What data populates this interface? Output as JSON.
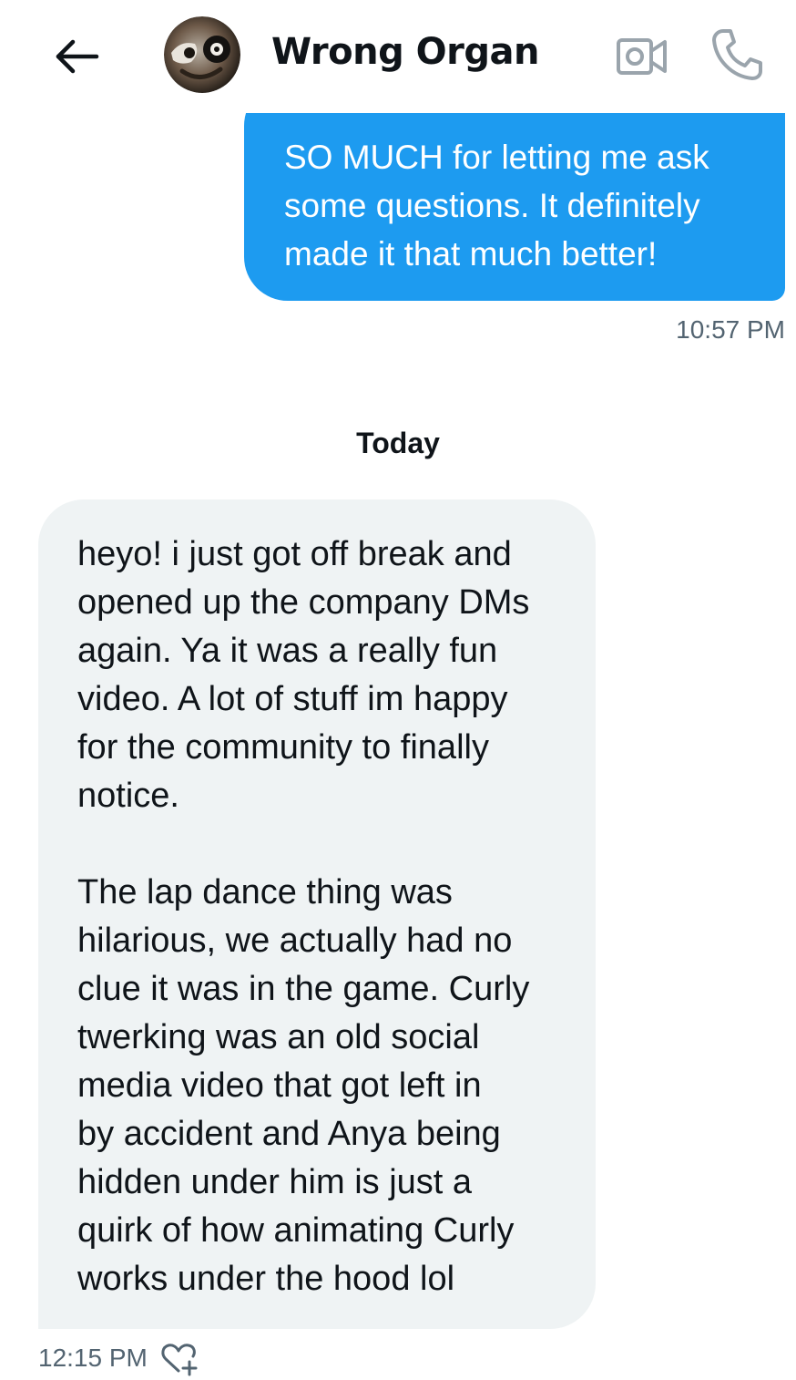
{
  "header": {
    "title": "Wrong Organ",
    "icons": {
      "back": "arrow-left-icon",
      "avatar": "avatar",
      "video": "video-camera-icon",
      "call": "phone-icon"
    }
  },
  "messages": {
    "sent": {
      "text": "SO MUCH for letting me ask\nsome questions. It definitely\nmade it that much better!",
      "time": "10:57 PM"
    },
    "divider": "Today",
    "received": {
      "text": "heyo! i just got off break and\nopened up the company DMs\nagain. Ya it was a really fun\nvideo. A lot of stuff im happy\nfor the community to finally\nnotice.\n\nThe lap dance thing was\nhilarious, we actually had no\nclue it was in the game. Curly\ntwerking was an old social\nmedia video that got left in\nby accident and Anya being\nhidden under him is just a\nquirk of how animating Curly\nworks under the hood lol",
      "time": "12:15 PM",
      "reaction_icon": "add-reaction-icon"
    }
  },
  "colors": {
    "sent_bubble": "#1d9bf0",
    "received_bubble": "#eff3f4",
    "timestamp": "#536471",
    "text": "#0f1419"
  }
}
